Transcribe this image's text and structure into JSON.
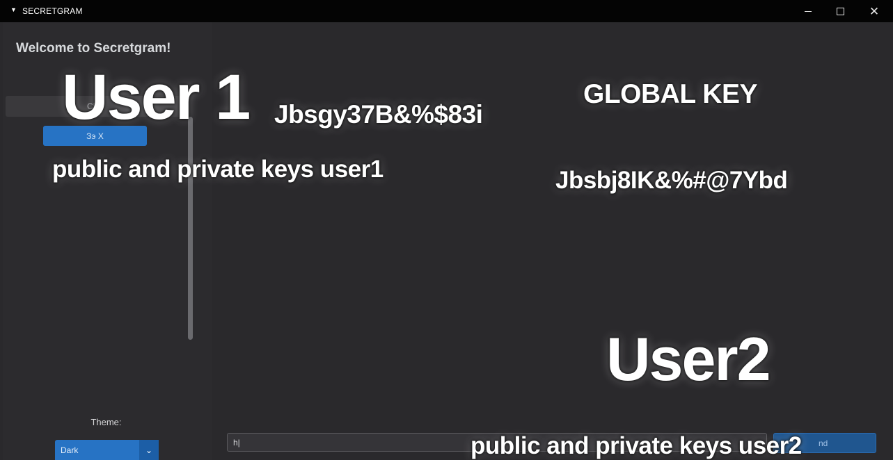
{
  "titlebar": {
    "title": "SECRETGRAM",
    "menu_icon": "triangle-down-icon",
    "minimize_icon": "minimize-icon",
    "maximize_icon": "maximize-icon",
    "close_icon": "close-icon"
  },
  "sidebar": {
    "welcome": "Welcome to Secretgram!",
    "chat_item_label": "Cha",
    "button_label": "Зэ X",
    "theme_label": "Theme:",
    "theme_value": "Dark",
    "theme_arrow_icon": "chevron-down-icon"
  },
  "main": {
    "input_value": "h|",
    "send_label": "nd"
  },
  "overlay": {
    "user1": "User 1",
    "user1_key": "Jbsgy37B&%$83i",
    "user1_caption": "public and private keys user1",
    "global_title": "GLOBAL KEY",
    "global_key": "Jbsbj8IK&%#@7Ybd",
    "user2": "User2",
    "user2_caption": "public and private keys user2"
  },
  "colors": {
    "titlebar": "#040404",
    "sidebar": "#2c2b2e",
    "main": "#2a292c",
    "accent": "#2773c4"
  }
}
